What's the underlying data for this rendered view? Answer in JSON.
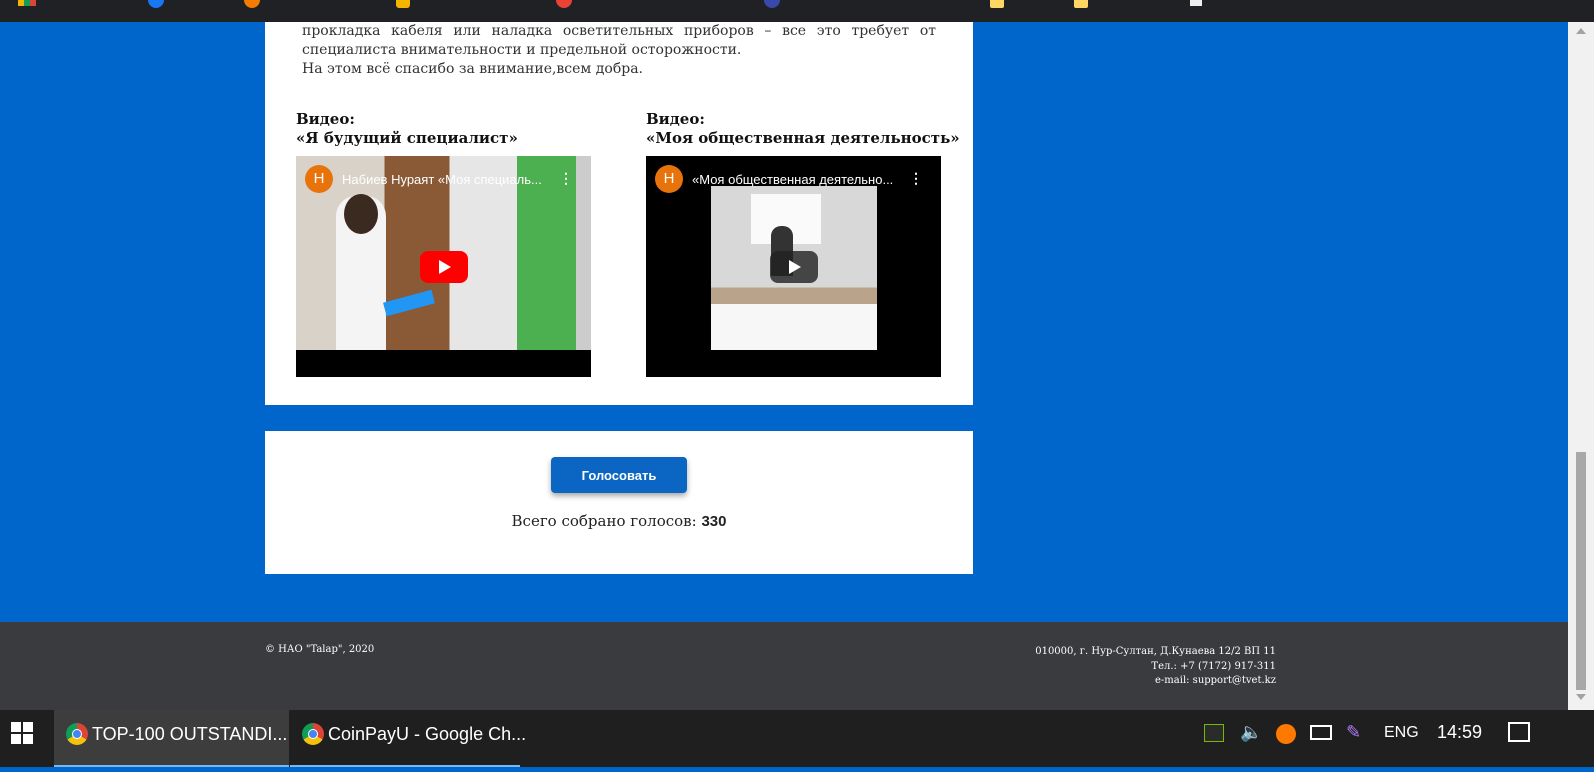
{
  "intro": {
    "line1": "прокладка кабеля или наладка осветительных приборов – все это требует от специалиста внимательности и предельной осторожности.",
    "line2": "На этом всё спасибо за внимание,всем добра."
  },
  "videos": [
    {
      "heading": "Видео:",
      "title": "«Я будущий специалист»",
      "avatar": "Н",
      "caption": "Набиев Нураят «Моя специаль...",
      "menu": "⋮"
    },
    {
      "heading": "Видео:",
      "title": "«Моя общественная деятельность»",
      "avatar": "Н",
      "caption": "«Моя общественная деятельно...",
      "menu": "⋮"
    }
  ],
  "vote": {
    "button": "Голосовать",
    "total_label": "Всего собрано голосов: ",
    "total_value": "330"
  },
  "footer": {
    "copyright": "© НАО \"Talap\", 2020",
    "address": "010000, г. Нур-Султан, Д.Кунаева 12/2 ВП 11",
    "phone": "Тел.: +7 (7172) 917-311",
    "email": "e-mail: support@tvet.kz"
  },
  "taskbar": {
    "items": [
      {
        "label": "TOP-100 OUTSTANDI..."
      },
      {
        "label": "CoinPayU - Google Ch..."
      }
    ],
    "lang": "ENG",
    "time": "14:59"
  },
  "colors": {
    "page_bg": "#0066cc",
    "button": "#0a66c2",
    "footer_bg": "#3a3b3e",
    "taskbar_bg": "#1f1f1f",
    "play_red": "#ff0000"
  },
  "icons": [
    "windows-start-icon",
    "chrome-icon",
    "nvidia-icon",
    "volume-icon",
    "avast-icon",
    "network-icon",
    "pen-icon",
    "notifications-icon",
    "play-icon"
  ]
}
